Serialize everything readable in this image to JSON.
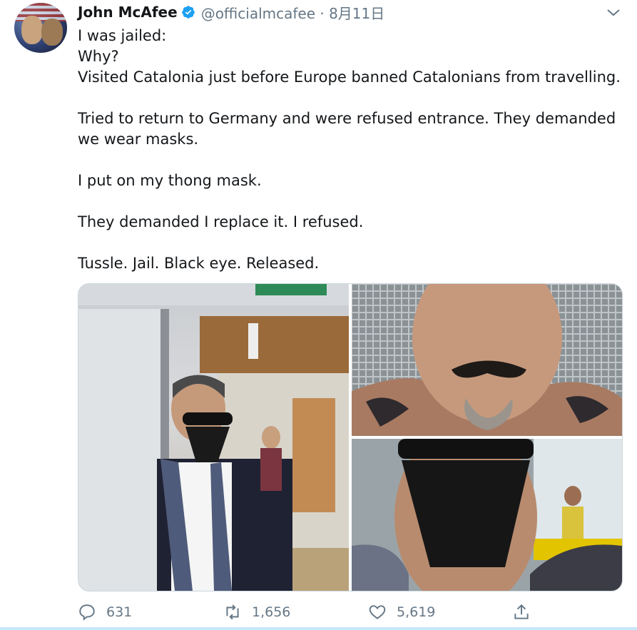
{
  "tweet": {
    "author_name": "John McAfee",
    "handle_and_date": "@officialmcafee · 8月11日",
    "lines": [
      "I was jailed:",
      "Why?",
      "Visited Catalonia just before Europe banned Catalonians from travelling.",
      "",
      "Tried to return to Germany and were refused entrance. They demanded we wear masks.",
      "",
      "I put on my thong mask.",
      "",
      "They demanded I replace it. I refused.",
      "",
      "Tussle. Jail. Black eye.  Released."
    ]
  },
  "actions": {
    "reply_count": "631",
    "retweet_count": "1,656",
    "like_count": "5,619"
  },
  "colors": {
    "verified": "#1da1f2",
    "secondary_text": "#657786",
    "primary_text": "#14171a"
  },
  "icons": [
    "verified-badge-icon",
    "chevron-down-icon",
    "reply-icon",
    "retweet-icon",
    "like-icon",
    "share-icon"
  ]
}
